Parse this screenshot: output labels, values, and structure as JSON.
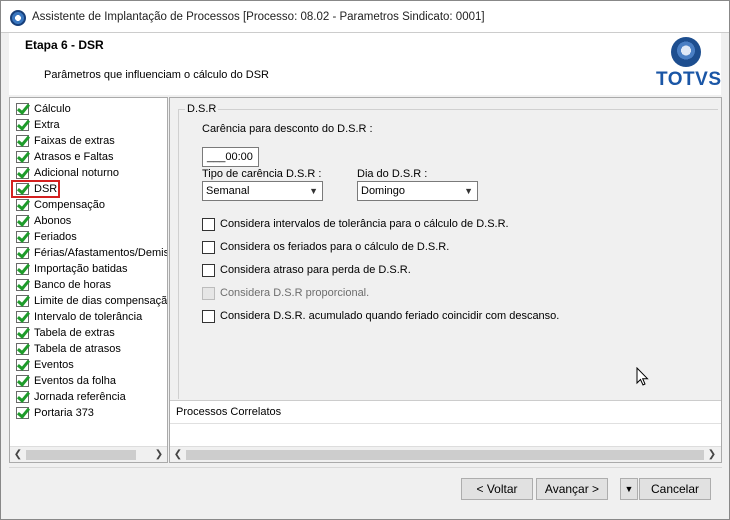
{
  "window": {
    "title": "Assistente de Implantação de Processos [Processo: 08.02 - Parametros Sindicato: 0001]"
  },
  "header": {
    "step": "Etapa 6 - DSR",
    "description": "Parâmetros que influenciam o cálculo do DSR",
    "logo_text": "TOTVS"
  },
  "tree": {
    "items": [
      {
        "label": "Cálculo",
        "checked": true
      },
      {
        "label": "Extra",
        "checked": true
      },
      {
        "label": "Faixas de extras",
        "checked": true
      },
      {
        "label": "Atrasos e Faltas",
        "checked": true
      },
      {
        "label": "Adicional noturno",
        "checked": true
      },
      {
        "label": "DSR",
        "checked": true,
        "selected": true
      },
      {
        "label": "Compensação",
        "checked": true
      },
      {
        "label": "Abonos",
        "checked": true
      },
      {
        "label": "Feriados",
        "checked": true
      },
      {
        "label": "Férias/Afastamentos/Demis",
        "checked": true
      },
      {
        "label": "Importação batidas",
        "checked": true
      },
      {
        "label": "Banco de horas",
        "checked": true
      },
      {
        "label": "Limite de dias compensação",
        "checked": true
      },
      {
        "label": "Intervalo de tolerância",
        "checked": true
      },
      {
        "label": "Tabela de extras",
        "checked": true
      },
      {
        "label": "Tabela de atrasos",
        "checked": true
      },
      {
        "label": "Eventos",
        "checked": true
      },
      {
        "label": "Eventos da folha",
        "checked": true
      },
      {
        "label": "Jornada referência",
        "checked": true
      },
      {
        "label": "Portaria 373",
        "checked": true
      }
    ]
  },
  "dsr": {
    "group_title": "D.S.R",
    "carencia_label": "Carência para desconto do D.S.R :",
    "carencia_value": "___00:00",
    "tipo_label": "Tipo de carência D.S.R :",
    "tipo_value": "Semanal",
    "dia_label": "Dia do D.S.R :",
    "dia_value": "Domingo",
    "options": [
      {
        "label": "Considera intervalos de tolerância para o cálculo de D.S.R.",
        "checked": false,
        "enabled": true
      },
      {
        "label": "Considera os feriados para o cálculo de D.S.R.",
        "checked": false,
        "enabled": true
      },
      {
        "label": "Considera atraso para perda de D.S.R.",
        "checked": false,
        "enabled": true
      },
      {
        "label": "Considera D.S.R proporcional.",
        "checked": false,
        "enabled": false
      },
      {
        "label": "Considera D.S.R. acumulado quando feriado coincidir com descanso.",
        "checked": false,
        "enabled": true
      }
    ]
  },
  "correlatos": {
    "title": "Processos Correlatos"
  },
  "buttons": {
    "back": "< Voltar",
    "next": "Avançar >",
    "cancel": "Cancelar"
  },
  "colors": {
    "accent": "#1a56a6",
    "selection_border": "#d42020",
    "check_green": "#1e9b2a"
  }
}
